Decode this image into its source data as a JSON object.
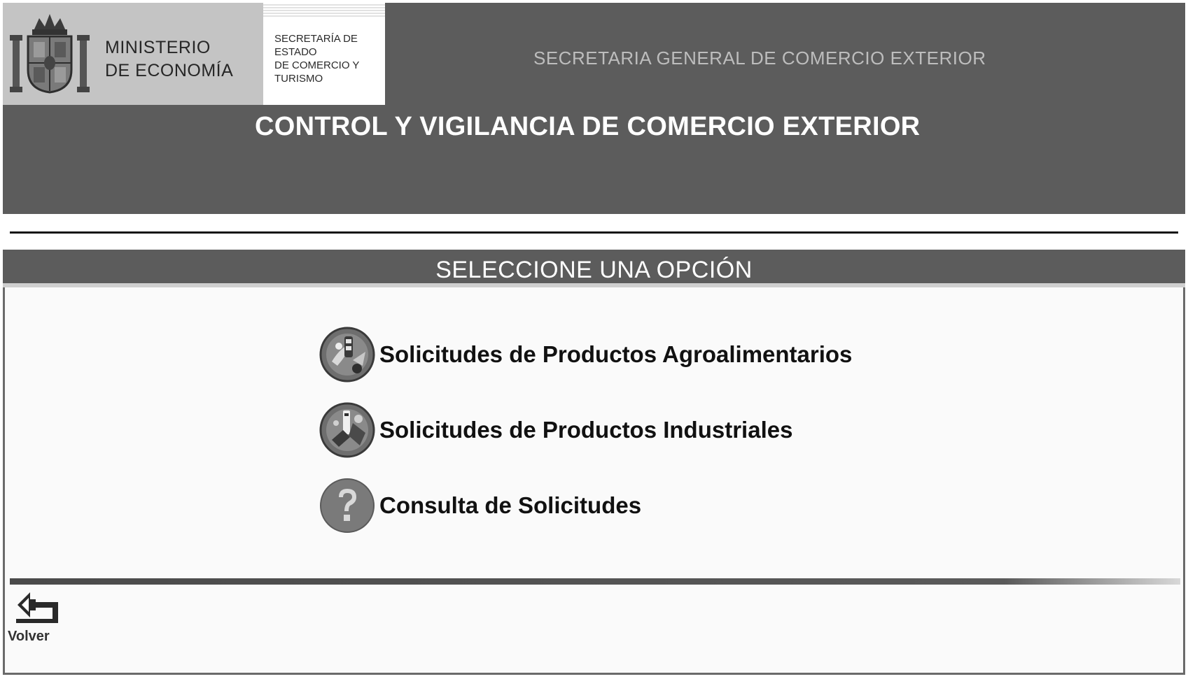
{
  "header": {
    "ministry_line1": "MINISTERIO",
    "ministry_line2": "DE ECONOMÍA",
    "secretaria_lines": [
      "SECRETARÍA DE",
      "ESTADO",
      "DE COMERCIO Y",
      "TURISMO"
    ],
    "general_title": "SECRETARIA GENERAL DE COMERCIO EXTERIOR",
    "main_title": "CONTROL Y VIGILANCIA DE COMERCIO EXTERIOR"
  },
  "panel": {
    "title": "SELECCIONE UNA OPCIÓN",
    "options": [
      {
        "label": "Solicitudes de Productos Agroalimentarios",
        "icon": "agrifood-icon"
      },
      {
        "label": "Solicitudes de Productos Industriales",
        "icon": "industrial-icon"
      },
      {
        "label": "Consulta de Solicitudes",
        "icon": "question-icon"
      }
    ]
  },
  "footer": {
    "back_label": "Volver",
    "back_icon": "back-arrow-icon"
  },
  "colors": {
    "header_bg": "#5c5c5c",
    "logo_bg": "#c4c4c4",
    "panel_bg": "#fafafa",
    "title_text": "#ffffff"
  }
}
